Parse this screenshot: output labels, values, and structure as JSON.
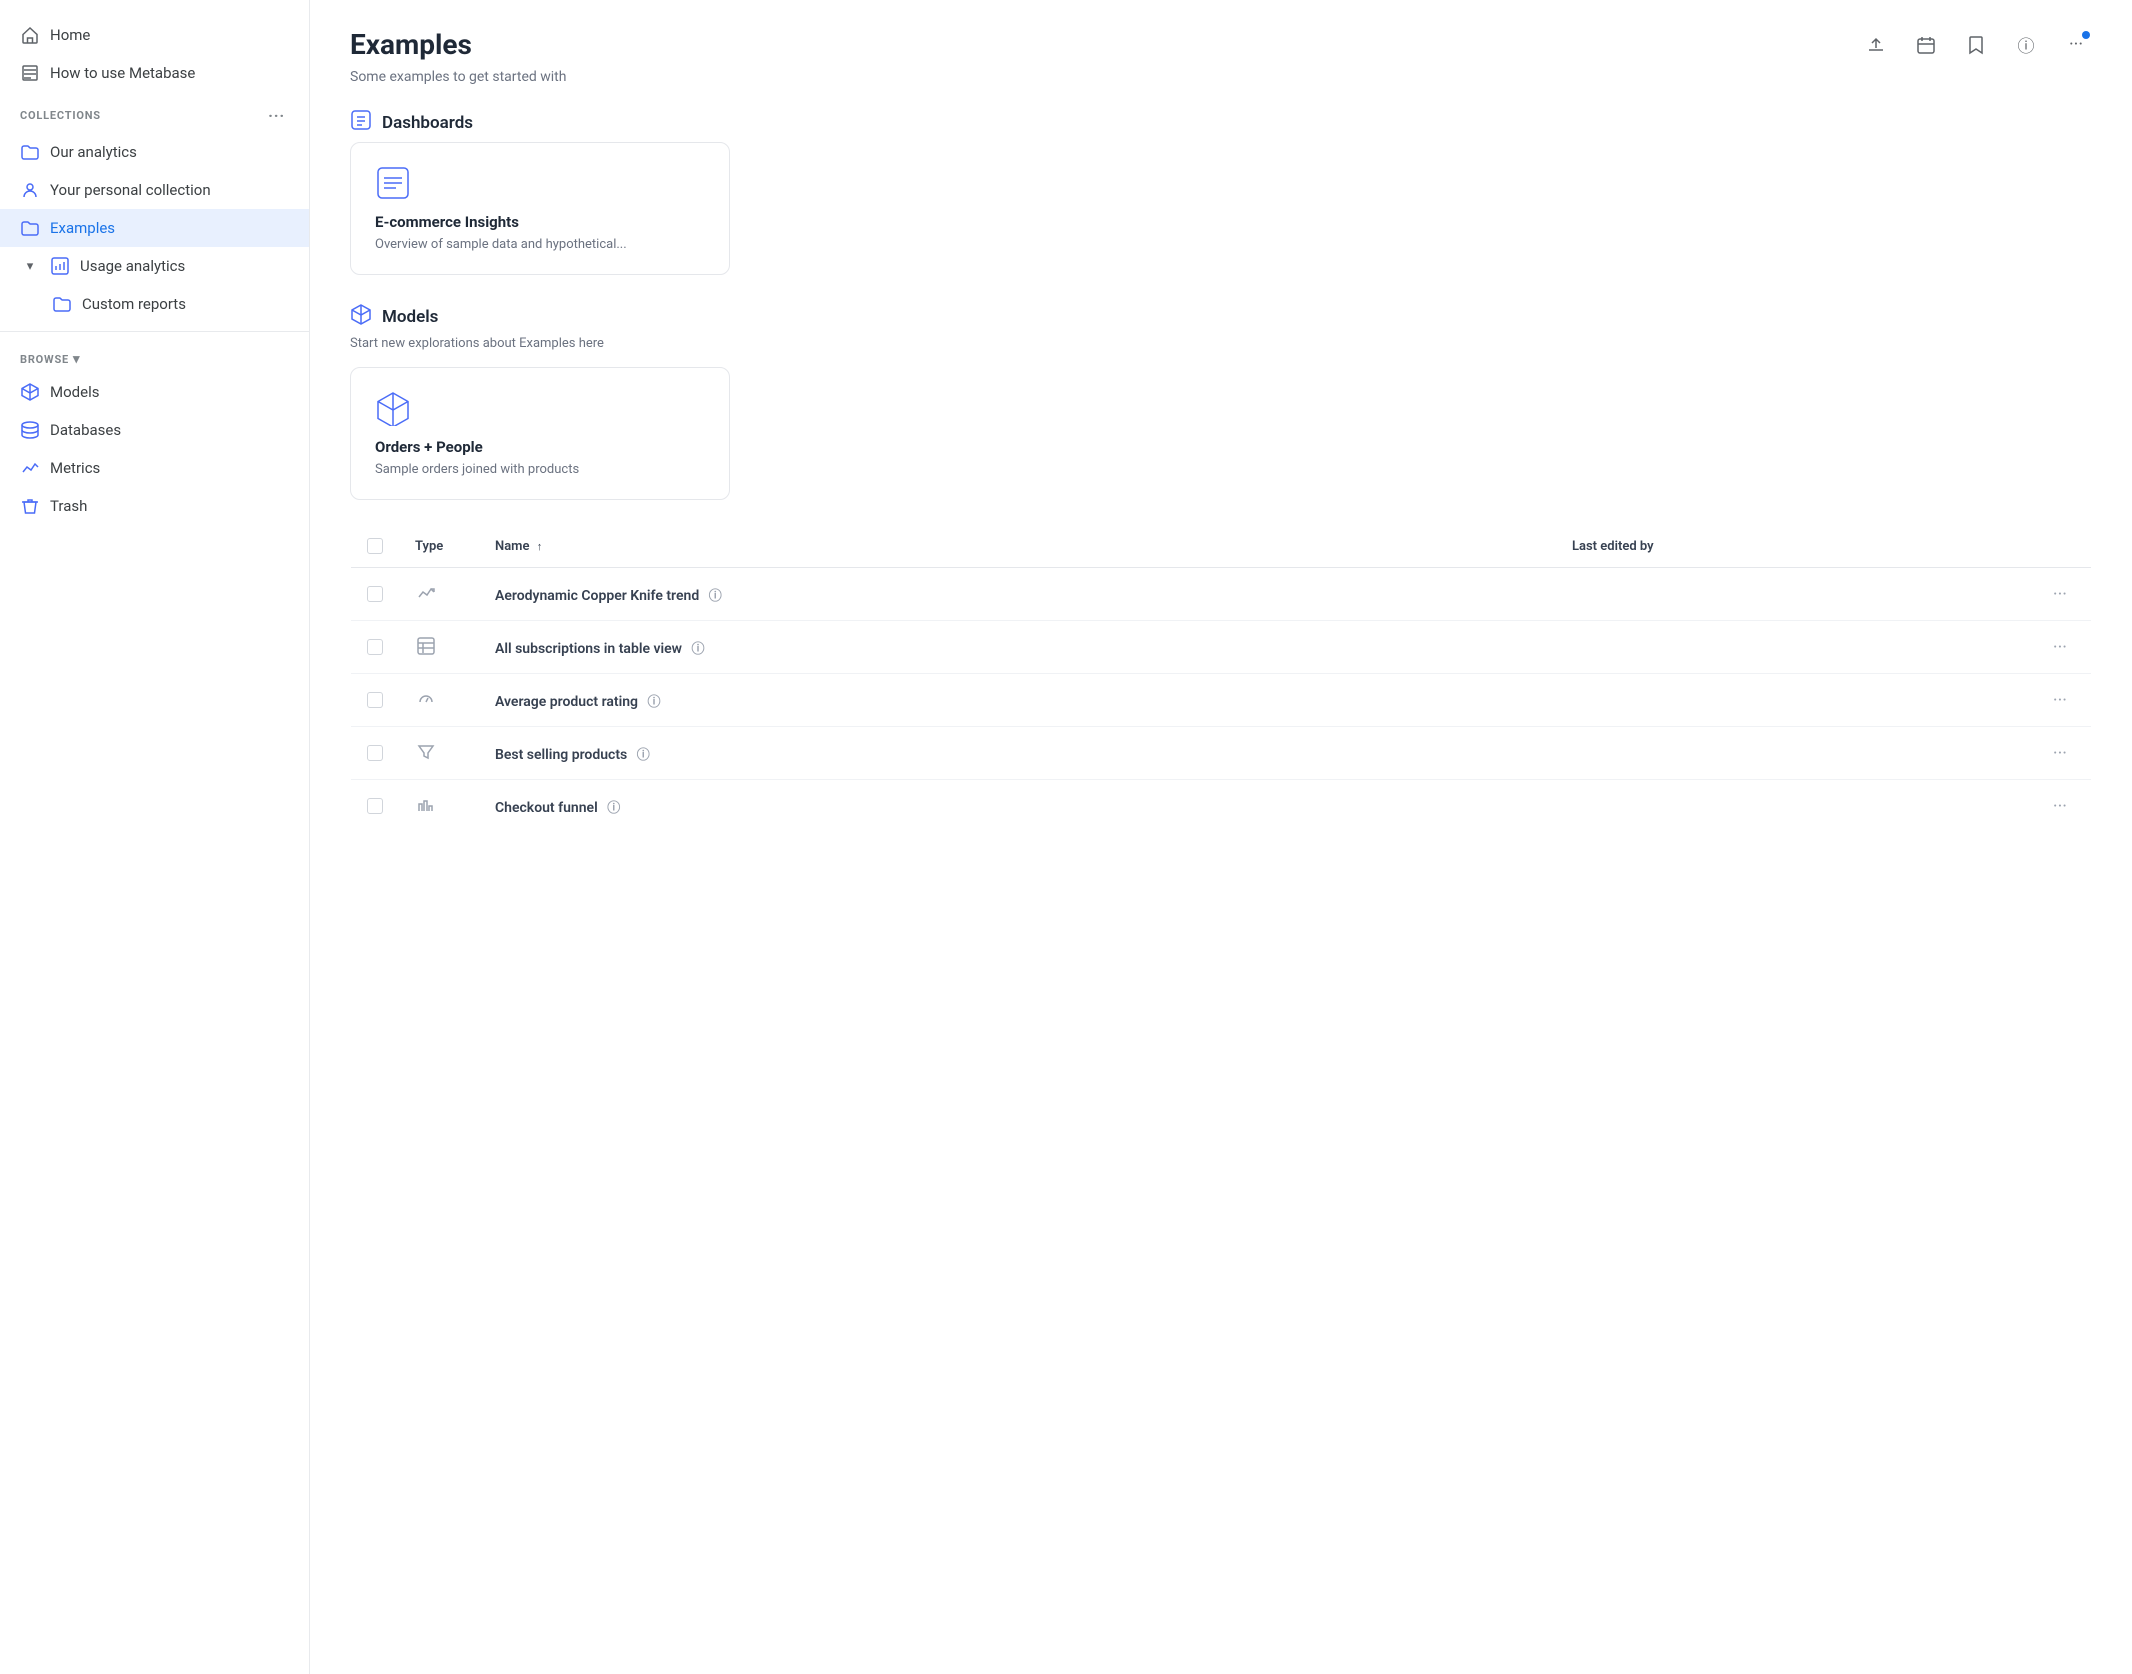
{
  "sidebar": {
    "nav_items": [
      {
        "id": "home",
        "label": "Home",
        "icon": "home",
        "active": false,
        "indent": 0
      },
      {
        "id": "how-to-use",
        "label": "How to use Metabase",
        "icon": "book",
        "active": false,
        "indent": 0
      }
    ],
    "collections_header": "COLLECTIONS",
    "collections_items": [
      {
        "id": "our-analytics",
        "label": "Our analytics",
        "icon": "folder",
        "active": false
      },
      {
        "id": "personal",
        "label": "Your personal collection",
        "icon": "person-folder",
        "active": false
      },
      {
        "id": "examples",
        "label": "Examples",
        "icon": "folder",
        "active": true
      }
    ],
    "usage_analytics": {
      "label": "Usage analytics",
      "icon": "analytics",
      "expanded": true,
      "children": [
        {
          "id": "custom-reports",
          "label": "Custom reports",
          "icon": "folder"
        }
      ]
    },
    "browse_header": "BROWSE",
    "browse_items": [
      {
        "id": "models",
        "label": "Models",
        "icon": "cube"
      },
      {
        "id": "databases",
        "label": "Databases",
        "icon": "database"
      },
      {
        "id": "metrics",
        "label": "Metrics",
        "icon": "chart"
      },
      {
        "id": "trash",
        "label": "Trash",
        "icon": "trash"
      }
    ]
  },
  "main": {
    "title": "Examples",
    "subtitle": "Some examples to get started with",
    "header_actions": {
      "upload_icon": "upload",
      "calendar_icon": "calendar",
      "bookmark_icon": "bookmark",
      "info_icon": "info",
      "more_icon": "more"
    },
    "sections": {
      "dashboards": {
        "label": "Dashboards",
        "card": {
          "title": "E-commerce Insights",
          "description": "Overview of sample data and hypothetical..."
        }
      },
      "models": {
        "label": "Models",
        "subtitle": "Start new explorations about Examples here",
        "card": {
          "title": "Orders + People",
          "description": "Sample orders joined with products"
        }
      }
    },
    "table": {
      "columns": [
        {
          "id": "checkbox",
          "label": ""
        },
        {
          "id": "type",
          "label": "Type"
        },
        {
          "id": "name",
          "label": "Name",
          "sort": "asc"
        },
        {
          "id": "lastedit",
          "label": "Last edited by"
        }
      ],
      "rows": [
        {
          "id": 1,
          "type": "trend",
          "type_icon": "↗",
          "name": "Aerodynamic Copper Knife trend",
          "show_info": true,
          "last_edited": ""
        },
        {
          "id": 2,
          "type": "table",
          "type_icon": "table",
          "name": "All subscriptions in table view",
          "show_info": true,
          "last_edited": ""
        },
        {
          "id": 3,
          "type": "gauge",
          "type_icon": "gauge",
          "name": "Average product rating",
          "show_info": true,
          "last_edited": ""
        },
        {
          "id": 4,
          "type": "funnel",
          "type_icon": "funnel",
          "name": "Best selling products",
          "show_info": true,
          "last_edited": ""
        },
        {
          "id": 5,
          "type": "bar",
          "type_icon": "bar",
          "name": "Checkout funnel",
          "show_info": true,
          "last_edited": ""
        }
      ]
    }
  }
}
